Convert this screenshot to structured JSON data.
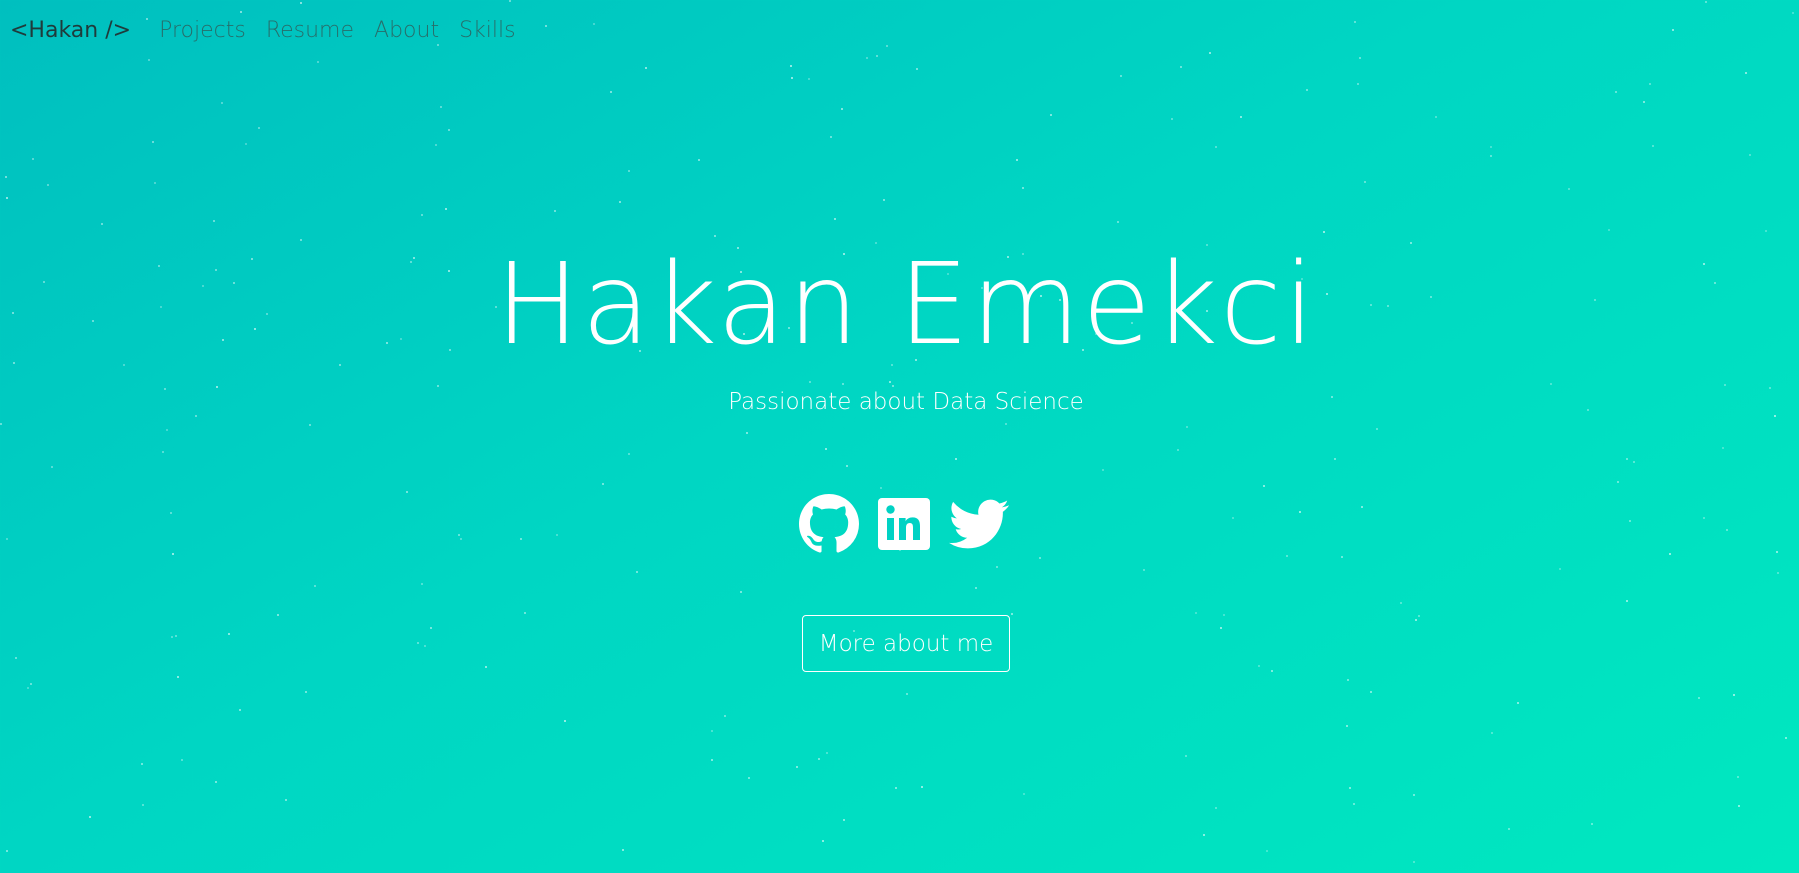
{
  "nav": {
    "brand": "<Hakan />",
    "links": [
      "Projects",
      "Resume",
      "About",
      "Skills"
    ]
  },
  "hero": {
    "name": "Hakan Emekci",
    "subtitle": "Passionate about Data Science",
    "cta_label": "More about me"
  },
  "socials": [
    {
      "icon": "github-icon"
    },
    {
      "icon": "linkedin-icon"
    },
    {
      "icon": "twitter-icon"
    }
  ],
  "colors": {
    "gradient_start": "#00bfbf",
    "gradient_end": "#00e8c0",
    "text": "#ffffff",
    "nav_text": "#2f5f5c"
  }
}
